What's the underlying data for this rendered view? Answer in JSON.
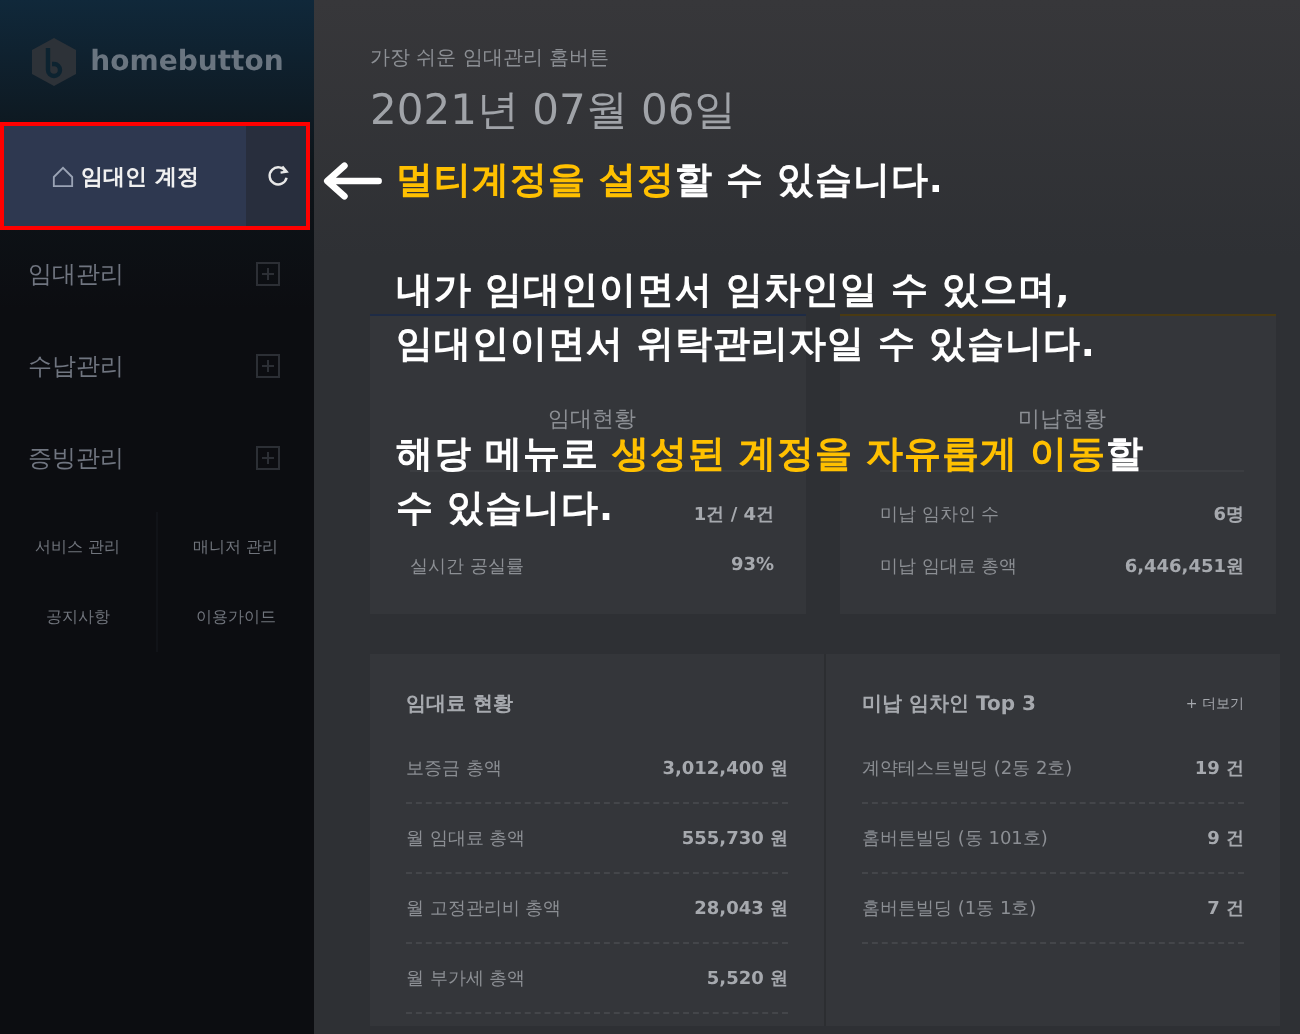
{
  "sidebar": {
    "logo": "homebutton",
    "account": {
      "label": "임대인 계정"
    },
    "menu": [
      {
        "label": "임대관리",
        "expanded": false
      },
      {
        "label": "수납관리",
        "expanded": false
      },
      {
        "label": "증빙관리",
        "expanded": false
      }
    ],
    "links": [
      "서비스 관리",
      "매니저 관리",
      "공지사항",
      "이용가이드"
    ]
  },
  "header": {
    "subtitle": "가장 쉬운 임대관리 홈버튼",
    "date": "2021년 07월 06일"
  },
  "summary_cards": [
    {
      "caption": "임대현황",
      "rows": [
        {
          "label": "",
          "value": "1건 / 4건"
        },
        {
          "label": "실시간 공실률",
          "value": "93%"
        }
      ]
    },
    {
      "caption": "미납현황",
      "rows": [
        {
          "label": "미납 임차인 수",
          "value": "6명"
        },
        {
          "label": "미납 임대료 총액",
          "value": "6,446,451원"
        }
      ]
    }
  ],
  "rent_status": {
    "title": "임대료 현황",
    "rows": [
      {
        "label": "보증금 총액",
        "value": "3,012,400 원"
      },
      {
        "label": "월 임대료 총액",
        "value": "555,730 원"
      },
      {
        "label": "월 고정관리비 총액",
        "value": "28,043 원"
      },
      {
        "label": "월 부가세 총액",
        "value": "5,520 원"
      }
    ]
  },
  "top_unpaid": {
    "title": "미납 임차인 Top 3",
    "more": "+ 더보기",
    "rows": [
      {
        "label": "계약테스트빌딩 (2동 2호)",
        "value": "19 건"
      },
      {
        "label": "홈버튼빌딩 (동 101호)",
        "value": "9 건"
      },
      {
        "label": "홈버튼빌딩 (1동 1호)",
        "value": "7 건"
      }
    ]
  },
  "callouts": [
    {
      "arrow": true,
      "lines": [
        "**멀티계정을 설정**할 수 있습니다."
      ]
    },
    {
      "arrow": false,
      "lines": [
        "내가 임대인이면서 임차인일 수 있으며,",
        "임대인이면서 위탁관리자일 수 있습니다."
      ]
    },
    {
      "arrow": false,
      "lines": [
        "해당 메뉴로 **생성된 계정을 자유롭게 이동**할",
        "수 있습니다."
      ]
    }
  ]
}
